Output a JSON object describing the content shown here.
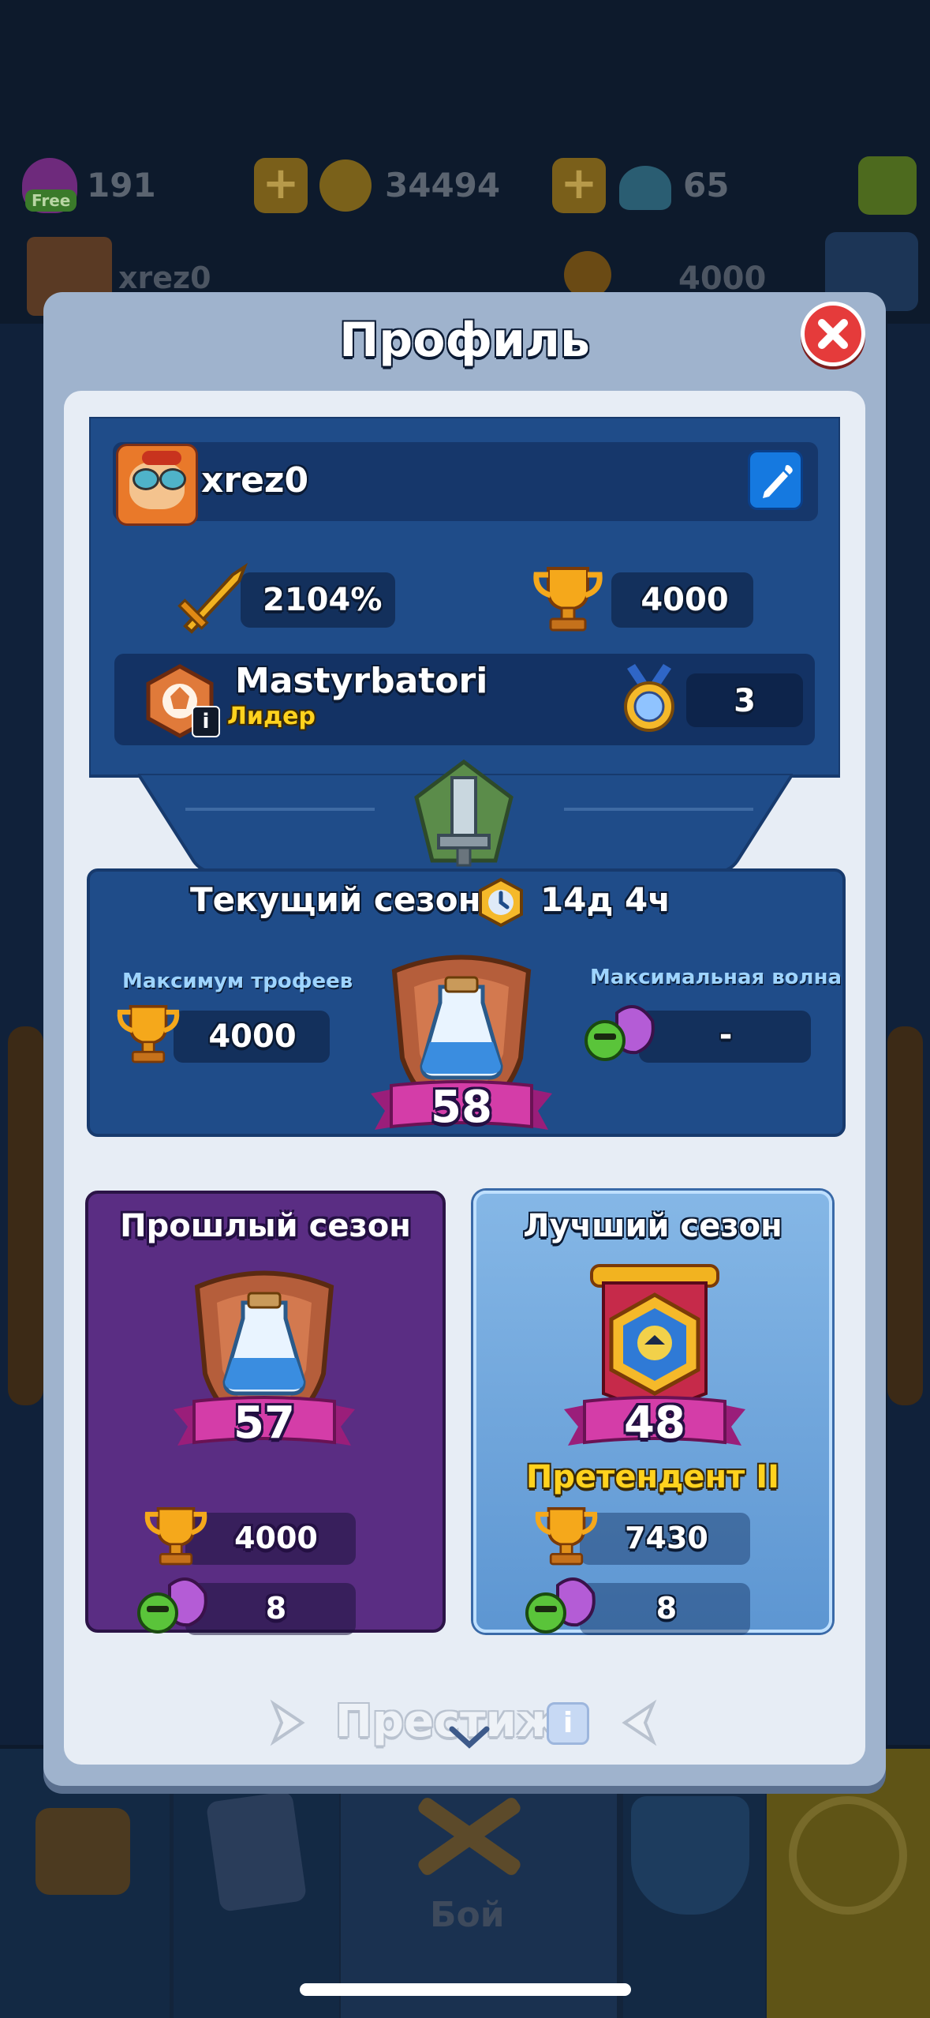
{
  "topbar": {
    "gems_label": "Free",
    "gems_value": "191",
    "coins_value": "34494",
    "crystals_value": "65"
  },
  "bg_profile": {
    "name": "xrez0",
    "trophies": "4000"
  },
  "modal": {
    "title": "Профиль"
  },
  "player": {
    "name": "xrez0",
    "power": "2104%",
    "trophies": "4000",
    "clan_name": "Mastyrbatori",
    "clan_role": "Лидер",
    "medals": "3"
  },
  "current_season": {
    "label": "Текущий сезон:",
    "timer": "14д 4ч",
    "max_trophies_label": "Максимум трофеев",
    "max_trophies": "4000",
    "max_wave_label": "Максимальная волна",
    "max_wave": "-",
    "rank": "58"
  },
  "last_season": {
    "title": "Прошлый сезон",
    "rank": "57",
    "trophies": "4000",
    "wave": "8"
  },
  "best_season": {
    "title": "Лучший сезон",
    "rank": "48",
    "league": "Претендент II",
    "trophies": "7430",
    "wave": "8"
  },
  "prestige": {
    "label": "Престиж"
  },
  "bottom_nav": {
    "battle_label": "Бой"
  },
  "colors": {
    "accent_red": "#e53b3b",
    "panel_blue": "#1e4d8d",
    "purple_card": "#5a2d83",
    "light_card": "#6aa6dd",
    "gold_text": "#ffd21e"
  }
}
